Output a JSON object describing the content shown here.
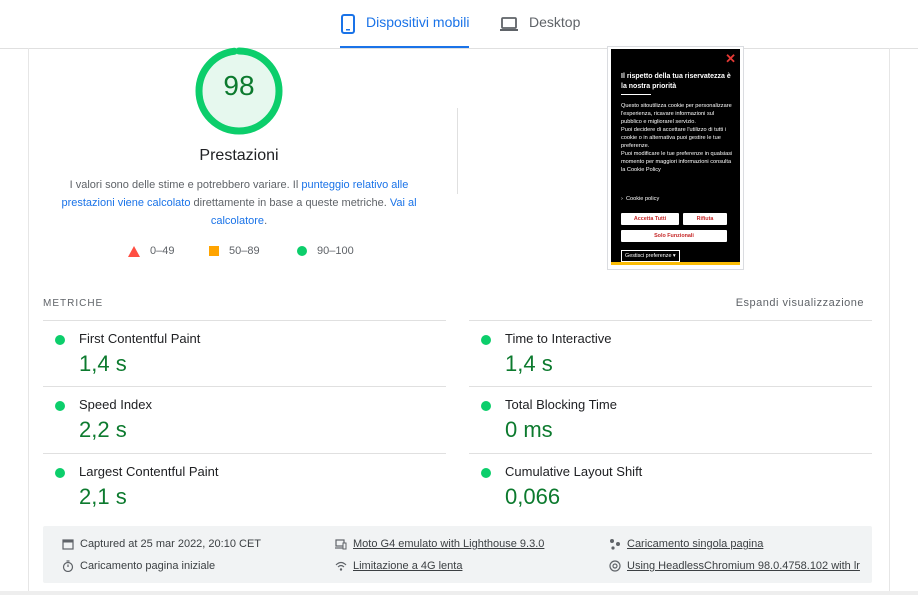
{
  "tabs": [
    {
      "label": "Dispositivi mobili",
      "active": true,
      "icon": "phone-icon"
    },
    {
      "label": "Desktop",
      "active": false,
      "icon": "laptop-icon"
    }
  ],
  "score": {
    "value": "98",
    "value_fraction": 0.98,
    "label": "Prestazioni",
    "color": "#0cce6b",
    "desc_1": "I valori sono delle stime e potrebbero variare. Il ",
    "desc_link_1": "punteggio relativo alle prestazioni viene calcolato",
    "desc_2": " direttamente in base a queste metriche. ",
    "desc_link_2": "Vai al calcolatore",
    "desc_3": "."
  },
  "legend": [
    {
      "range": "0–49",
      "shape": "triangle",
      "color": "#ff4e42"
    },
    {
      "range": "50–89",
      "shape": "square",
      "color": "#ffa400"
    },
    {
      "range": "90–100",
      "shape": "circle",
      "color": "#0cce6b"
    }
  ],
  "screenshot": {
    "title": "Il rispetto della tua riservatezza è la nostra priorità",
    "body_1": "Questo sitoutilizza cookie per personalizzare l'esperienza, ricavare informazioni sul pubblico  e migliorarel servizio.",
    "body_2": "Puoi decidere di accettare l'utilizzo di tutti i cookie o in alternativa puoi gestire le tue preferenze.",
    "body_3": "Puoi modificare le tue preferenze in qualsiasi momento per maggiori informazioni consulta la Cookie Policy",
    "policy": "Cookie policy",
    "accept": "Accetta Tutti",
    "reject": "Rifiuta",
    "functional": "Solo Funzionali",
    "prefs": "Gestisci preferenze ▾"
  },
  "metrics": {
    "heading": "METRICHE",
    "expand": "Espandi visualizzazione",
    "items": [
      {
        "name": "First Contentful Paint",
        "value": "1,4 s"
      },
      {
        "name": "Time to Interactive",
        "value": "1,4 s"
      },
      {
        "name": "Speed Index",
        "value": "2,2 s"
      },
      {
        "name": "Total Blocking Time",
        "value": "0 ms"
      },
      {
        "name": "Largest Contentful Paint",
        "value": "2,1 s"
      },
      {
        "name": "Cumulative Layout Shift",
        "value": "0,066"
      }
    ]
  },
  "footer": {
    "captured": "Captured at 25 mar 2022, 20:10 CET",
    "initial_load": "Caricamento pagina iniziale",
    "device": "Moto G4 emulato with Lighthouse 9.3.0",
    "throttle": "Limitazione a 4G lenta",
    "single_page": "Caricamento singola pagina",
    "browser": "Using HeadlessChromium 98.0.4758.102 with lr"
  }
}
